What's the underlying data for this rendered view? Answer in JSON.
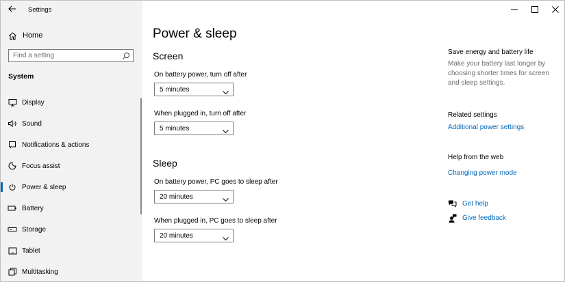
{
  "window": {
    "title": "Settings"
  },
  "sidebar": {
    "home_label": "Home",
    "search_placeholder": "Find a setting",
    "section_label": "System",
    "items": [
      {
        "label": "Display",
        "icon": "display-icon"
      },
      {
        "label": "Sound",
        "icon": "speaker-icon"
      },
      {
        "label": "Notifications & actions",
        "icon": "notification-icon"
      },
      {
        "label": "Focus assist",
        "icon": "moon-icon"
      },
      {
        "label": "Power & sleep",
        "icon": "power-icon",
        "active": true
      },
      {
        "label": "Battery",
        "icon": "battery-icon"
      },
      {
        "label": "Storage",
        "icon": "storage-icon"
      },
      {
        "label": "Tablet",
        "icon": "tablet-icon"
      },
      {
        "label": "Multitasking",
        "icon": "multitasking-icon"
      }
    ]
  },
  "main": {
    "title": "Power & sleep",
    "screen": {
      "heading": "Screen",
      "battery_label": "On battery power, turn off after",
      "battery_value": "5 minutes",
      "plugged_label": "When plugged in, turn off after",
      "plugged_value": "5 minutes"
    },
    "sleep": {
      "heading": "Sleep",
      "battery_label": "On battery power, PC goes to sleep after",
      "battery_value": "20 minutes",
      "plugged_label": "When plugged in, PC goes to sleep after",
      "plugged_value": "20 minutes"
    }
  },
  "right_panel": {
    "tip_heading": "Save energy and battery life",
    "tip_text": "Make your battery last longer by choosing shorter times for screen and sleep settings.",
    "related_heading": "Related settings",
    "related_link": "Additional power settings",
    "help_heading": "Help from the web",
    "help_link": "Changing power mode",
    "get_help": "Get help",
    "give_feedback": "Give feedback"
  },
  "colors": {
    "accent": "#0067b8",
    "sidebar_bg": "#f2f2f2",
    "secondary_text": "#6d6d6d"
  }
}
